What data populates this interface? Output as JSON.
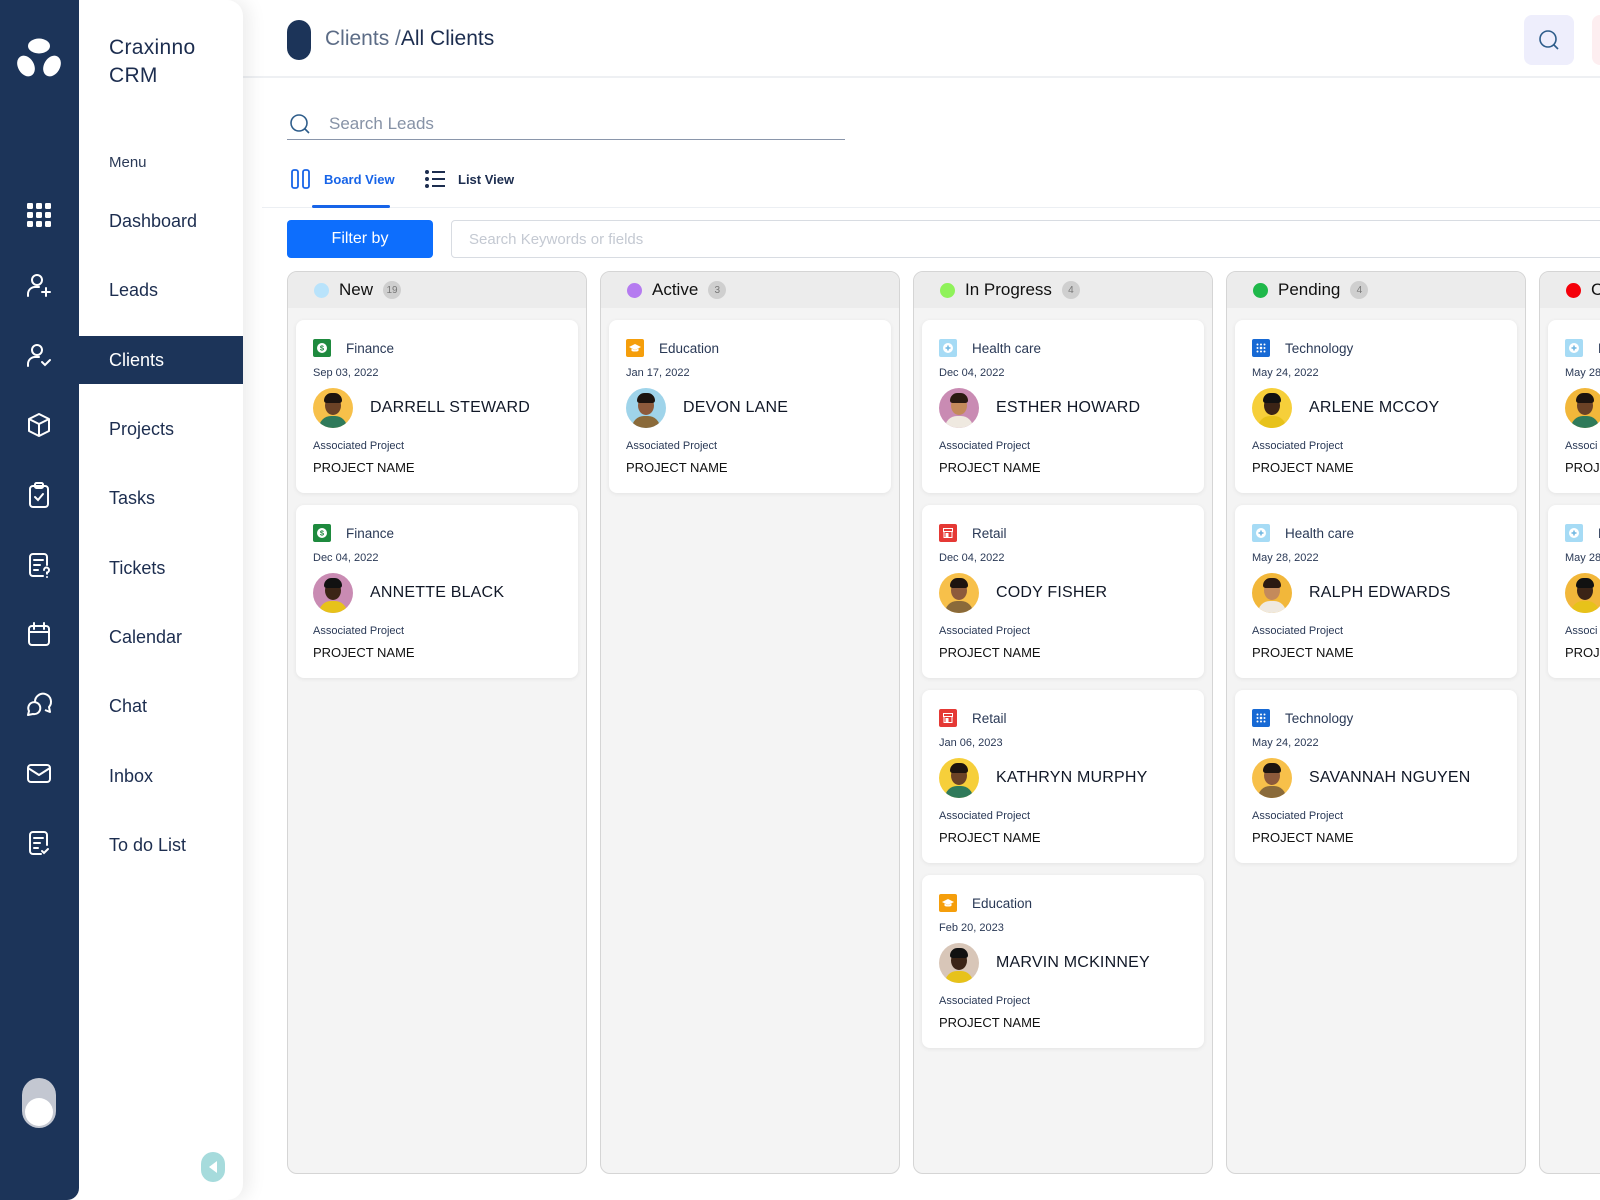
{
  "app": {
    "brand": "Craxinno CRM"
  },
  "menu": {
    "label": "Menu",
    "items": [
      {
        "label": "Dashboard",
        "icon": "grid-icon"
      },
      {
        "label": "Leads",
        "icon": "user-plus-icon"
      },
      {
        "label": "Clients",
        "icon": "user-check-icon",
        "active": true
      },
      {
        "label": "Projects",
        "icon": "box-icon"
      },
      {
        "label": "Tasks",
        "icon": "clipboard-check-icon"
      },
      {
        "label": "Tickets",
        "icon": "ticket-question-icon"
      },
      {
        "label": "Calendar",
        "icon": "calendar-icon"
      },
      {
        "label": "Chat",
        "icon": "chat-icon"
      },
      {
        "label": "Inbox",
        "icon": "mail-icon"
      },
      {
        "label": "To do List",
        "icon": "todo-list-icon"
      }
    ]
  },
  "header": {
    "breadcrumb_parent": "Clients /",
    "breadcrumb_current": "All Clients"
  },
  "search": {
    "placeholder": "Search Leads",
    "value": ""
  },
  "views": {
    "board_label": "Board View",
    "list_label": "List View",
    "active": "Board View"
  },
  "filter": {
    "button_label": "Filter by",
    "keyword_placeholder": "Search Keywords or fields"
  },
  "industries": {
    "Finance": {
      "color": "#1e8a3e",
      "icon": "dollar-icon"
    },
    "Education": {
      "color": "#f59e0b",
      "icon": "graduation-cap-icon"
    },
    "Health care": {
      "color": "#a6dbf5",
      "icon": "medical-plus-icon"
    },
    "Retail": {
      "color": "#e53935",
      "icon": "store-icon"
    },
    "Technology": {
      "color": "#1769d4",
      "icon": "circuit-icon"
    }
  },
  "board": {
    "assoc_label": "Associated Project",
    "columns": [
      {
        "title": "New",
        "count": "19",
        "color": "#b9e3fb",
        "cards": [
          {
            "industry": "Finance",
            "date": "Sep 03, 2022",
            "name": "DARRELL STEWARD",
            "project": "PROJECT NAME",
            "avatar_bg": "#f7c04a"
          },
          {
            "industry": "Finance",
            "date": "Dec 04, 2022",
            "name": "ANNETTE BLACK",
            "project": "PROJECT NAME",
            "avatar_bg": "#c98bb3"
          }
        ]
      },
      {
        "title": "Active",
        "count": "3",
        "color": "#b57bf0",
        "cards": [
          {
            "industry": "Education",
            "date": "Jan 17, 2022",
            "name": "DEVON LANE",
            "project": "PROJECT NAME",
            "avatar_bg": "#9fd4ea"
          }
        ]
      },
      {
        "title": "In Progress",
        "count": "4",
        "color": "#8ff25a",
        "cards": [
          {
            "industry": "Health care",
            "date": "Dec 04, 2022",
            "name": "ESTHER HOWARD",
            "project": "PROJECT NAME",
            "avatar_bg": "#c98bb3"
          },
          {
            "industry": "Retail",
            "date": "Dec 04, 2022",
            "name": "CODY FISHER",
            "project": "PROJECT NAME",
            "avatar_bg": "#f7c04a"
          },
          {
            "industry": "Retail",
            "date": "Jan 06, 2023",
            "name": "KATHRYN MURPHY",
            "project": "PROJECT NAME",
            "avatar_bg": "#f6cf3a"
          },
          {
            "industry": "Education",
            "date": "Feb 20, 2023",
            "name": "MARVIN MCKINNEY",
            "project": "PROJECT NAME",
            "avatar_bg": "#d8c6b8"
          }
        ]
      },
      {
        "title": "Pending",
        "count": "4",
        "color": "#1fb84a",
        "cards": [
          {
            "industry": "Technology",
            "date": "May 24, 2022",
            "name": "ARLENE MCCOY",
            "project": "PROJECT NAME",
            "avatar_bg": "#f6cf3a"
          },
          {
            "industry": "Health care",
            "date": "May 28, 2022",
            "name": "RALPH EDWARDS",
            "project": "PROJECT NAME",
            "avatar_bg": "#f2b73a"
          },
          {
            "industry": "Technology",
            "date": "May 24, 2022",
            "name": "SAVANNAH NGUYEN",
            "project": "PROJECT NAME",
            "avatar_bg": "#f7c04a"
          }
        ]
      },
      {
        "title": "C",
        "count": "",
        "color": "#f5000a",
        "cards": [
          {
            "industry": "Health care",
            "date": "May 28",
            "name": "",
            "project": "PROJ",
            "avatar_bg": "#f2b73a",
            "assoc": "Associ"
          },
          {
            "industry": "Health care",
            "date": "May 28",
            "name": "",
            "project": "PROJ",
            "avatar_bg": "#f2b73a",
            "assoc": "Associ"
          }
        ]
      }
    ]
  }
}
